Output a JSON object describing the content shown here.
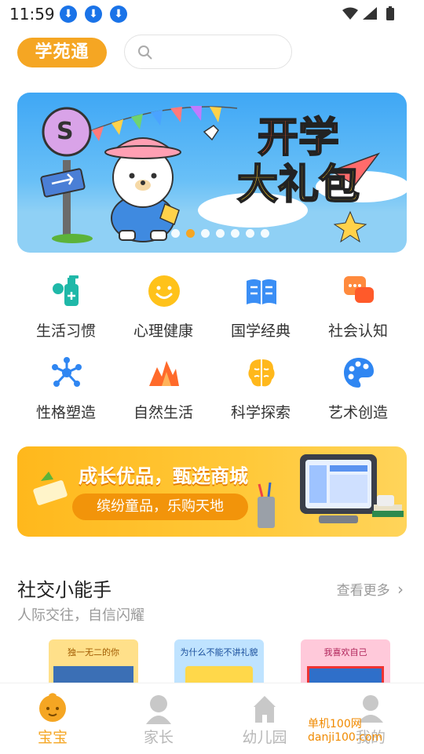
{
  "status": {
    "time": "11:59",
    "download_icon": "download-icon"
  },
  "app": {
    "logo": "学苑通",
    "search_placeholder": ""
  },
  "banner": {
    "title_line1": "开学",
    "title_line2": "大礼包",
    "sign_letter": "S",
    "slide_count": 7,
    "active_slide": 2
  },
  "categories": [
    {
      "label": "生活习惯",
      "icon": "hand-sanitizer-icon"
    },
    {
      "label": "心理健康",
      "icon": "smiley-icon"
    },
    {
      "label": "国学经典",
      "icon": "open-book-icon"
    },
    {
      "label": "社会认知",
      "icon": "chat-bubbles-icon"
    },
    {
      "label": "性格塑造",
      "icon": "molecule-icon"
    },
    {
      "label": "自然生活",
      "icon": "flame-mountain-icon"
    },
    {
      "label": "科学探索",
      "icon": "brain-icon"
    },
    {
      "label": "艺术创造",
      "icon": "palette-icon"
    }
  ],
  "mall": {
    "title": "成长优品，甄选商城",
    "subtitle": "缤纷童品，乐购天地"
  },
  "section": {
    "title": "社交小能手",
    "subtitle": "人际交往，自信闪耀",
    "more": "查看更多"
  },
  "books": [
    {
      "title": "独一无二的你"
    },
    {
      "title": "为什么不能不讲礼貌"
    },
    {
      "title": "我喜欢自己"
    }
  ],
  "tabs": [
    {
      "label": "宝宝",
      "icon": "baby-icon",
      "active": true
    },
    {
      "label": "家长",
      "icon": "parent-icon",
      "active": false
    },
    {
      "label": "幼儿园",
      "icon": "kindergarten-icon",
      "active": false
    },
    {
      "label": "我的",
      "icon": "profile-icon",
      "active": false
    }
  ],
  "watermark": "单机100网 danji100.com",
  "colors": {
    "accent": "#f5a623",
    "teal": "#1fb8a8",
    "blue": "#2f86f2"
  }
}
